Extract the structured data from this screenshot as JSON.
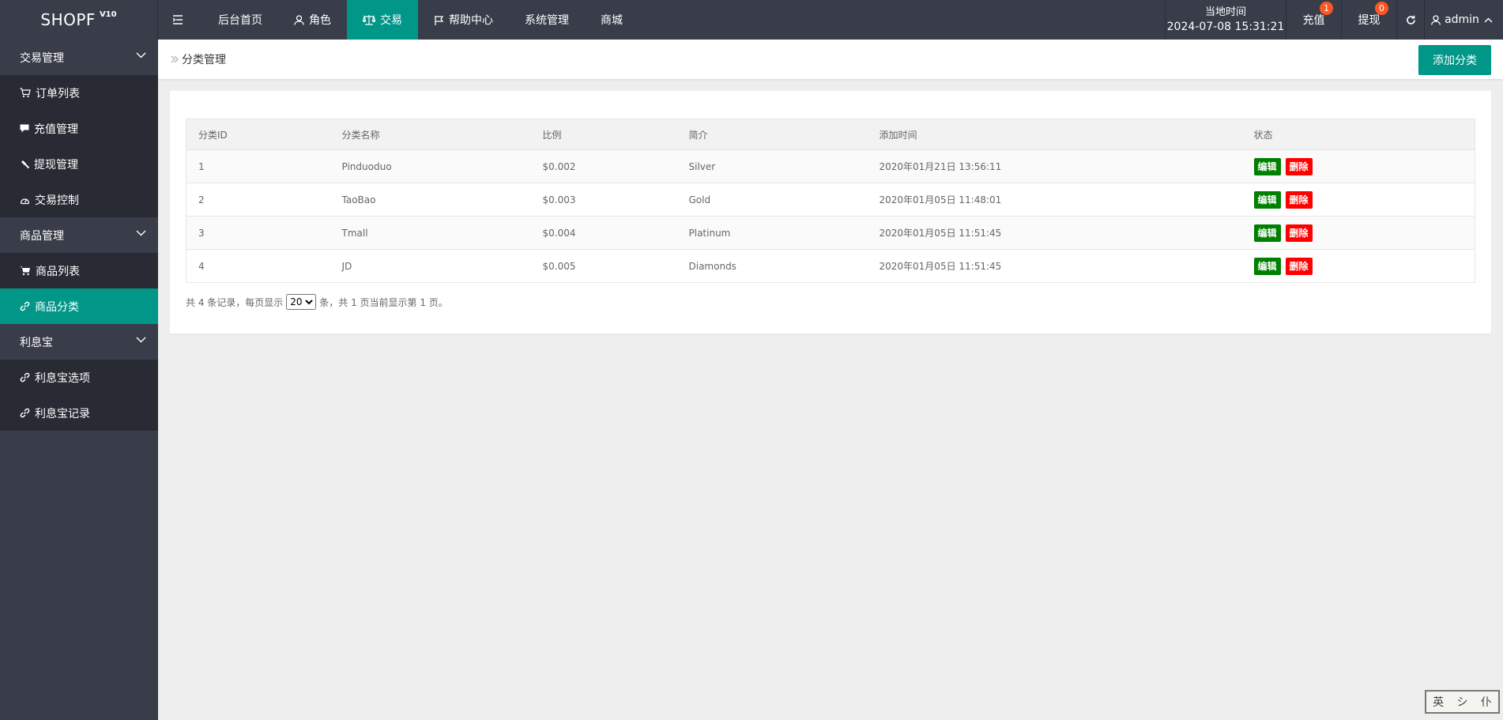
{
  "topbar": {
    "brand": "SHOPF",
    "version": "V10",
    "nav": [
      {
        "label": "后台首页"
      },
      {
        "label": "角色"
      },
      {
        "label": "交易"
      },
      {
        "label": "帮助中心"
      },
      {
        "label": "系统管理"
      },
      {
        "label": "商城"
      }
    ],
    "time_label": "当地时间",
    "time_value": "2024-07-08 15:31:21",
    "recharge_label": "充值",
    "recharge_badge": "1",
    "withdraw_label": "提现",
    "withdraw_badge": "0",
    "user_label": "admin"
  },
  "sidebar": {
    "groups": [
      {
        "title": "交易管理",
        "items": [
          {
            "label": "订单列表"
          },
          {
            "label": "充值管理"
          },
          {
            "label": "提现管理"
          },
          {
            "label": "交易控制"
          }
        ]
      },
      {
        "title": "商品管理",
        "items": [
          {
            "label": "商品列表"
          },
          {
            "label": "商品分类"
          }
        ]
      },
      {
        "title": "利息宝",
        "items": [
          {
            "label": "利息宝选项"
          },
          {
            "label": "利息宝记录"
          }
        ]
      }
    ]
  },
  "breadcrumb": {
    "current": "分类管理"
  },
  "add_button": "添加分类",
  "table": {
    "headers": [
      "分类ID",
      "分类名称",
      "比例",
      "简介",
      "添加时间",
      "状态"
    ],
    "rows": [
      {
        "id": "1",
        "name": "Pinduoduo",
        "ratio": "$0.002",
        "intro": "Silver",
        "time": "2020年01月21日 13:56:11"
      },
      {
        "id": "2",
        "name": "TaoBao",
        "ratio": "$0.003",
        "intro": "Gold",
        "time": "2020年01月05日 11:48:01"
      },
      {
        "id": "3",
        "name": "Tmall",
        "ratio": "$0.004",
        "intro": "Platinum",
        "time": "2020年01月05日 11:51:45"
      },
      {
        "id": "4",
        "name": "JD",
        "ratio": "$0.005",
        "intro": "Diamonds",
        "time": "2020年01月05日 11:51:45"
      }
    ],
    "edit_label": "编辑",
    "delete_label": "删除"
  },
  "pager": {
    "prefix": "共 4 条记录，每页显示",
    "page_size": "20",
    "suffix": "条，共 1 页当前显示第 1 页。"
  },
  "ime": {
    "c1": "英",
    "c2": "シ",
    "c3": "仆"
  },
  "colors": {
    "accent": "#009688",
    "topbar": "#393d49",
    "submenu": "#282b33",
    "edit": "#008000",
    "delete": "#ff0000",
    "badge": "#ff5722"
  }
}
